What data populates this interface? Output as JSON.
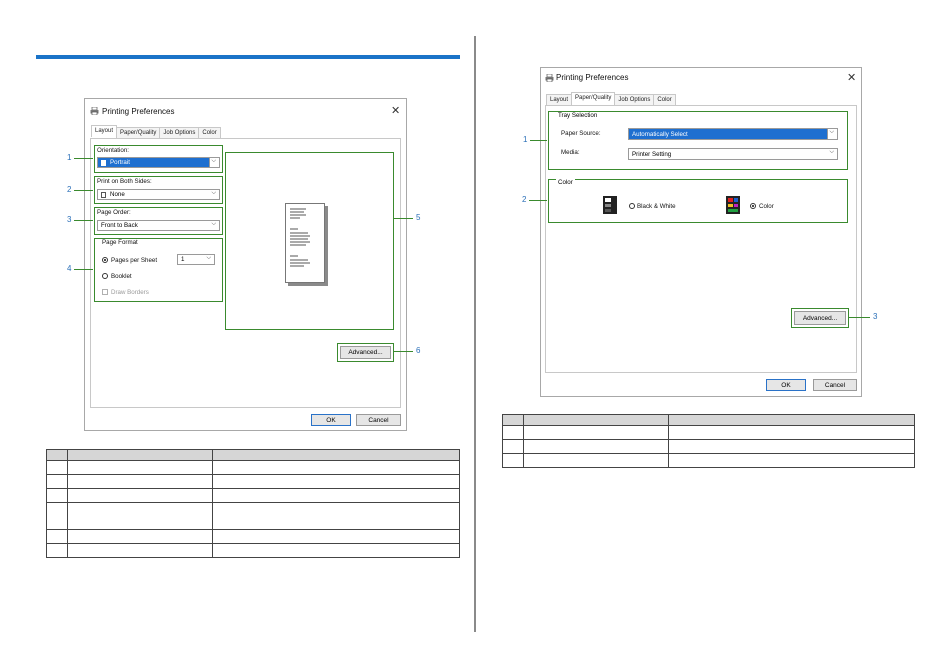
{
  "left_dialog": {
    "title": "Printing Preferences",
    "close": "✕",
    "tabs": [
      "Layout",
      "Paper/Quality",
      "Job Options",
      "Color"
    ],
    "active_tab": 0,
    "orientation_label": "Orientation:",
    "orientation_value": "Portrait",
    "both_sides_label": "Print on Both Sides:",
    "both_sides_value": "None",
    "page_order_label": "Page Order:",
    "page_order_value": "Front to Back",
    "page_format_title": "Page Format",
    "pages_per_sheet_label": "Pages per Sheet",
    "pages_per_sheet_value": "1",
    "booklet_label": "Booklet",
    "draw_borders_label": "Draw Borders",
    "advanced_button": "Advanced...",
    "ok_button": "OK",
    "cancel_button": "Cancel"
  },
  "left_callouts": [
    "1",
    "2",
    "3",
    "4",
    "5",
    "6"
  ],
  "right_dialog": {
    "title": "Printing Preferences",
    "close": "✕",
    "tabs": [
      "Layout",
      "Paper/Quality",
      "Job Options",
      "Color"
    ],
    "active_tab": 1,
    "tray_selection_title": "Tray Selection",
    "paper_source_label": "Paper Source:",
    "paper_source_value": "Automatically Select",
    "media_label": "Media:",
    "media_value": "Printer Setting",
    "color_title": "Color",
    "bw_label": "Black & White",
    "color_label": "Color",
    "advanced_button": "Advanced...",
    "ok_button": "OK",
    "cancel_button": "Cancel"
  },
  "right_callouts": [
    "1",
    "2",
    "3"
  ],
  "left_table_rows": 7,
  "right_table_rows": 3,
  "colors": {
    "accent_rule": "#1a73c8",
    "callout_green": "#3a8a2e",
    "callout_number": "#2a6fb8",
    "selection_blue": "#1e6fd0"
  }
}
